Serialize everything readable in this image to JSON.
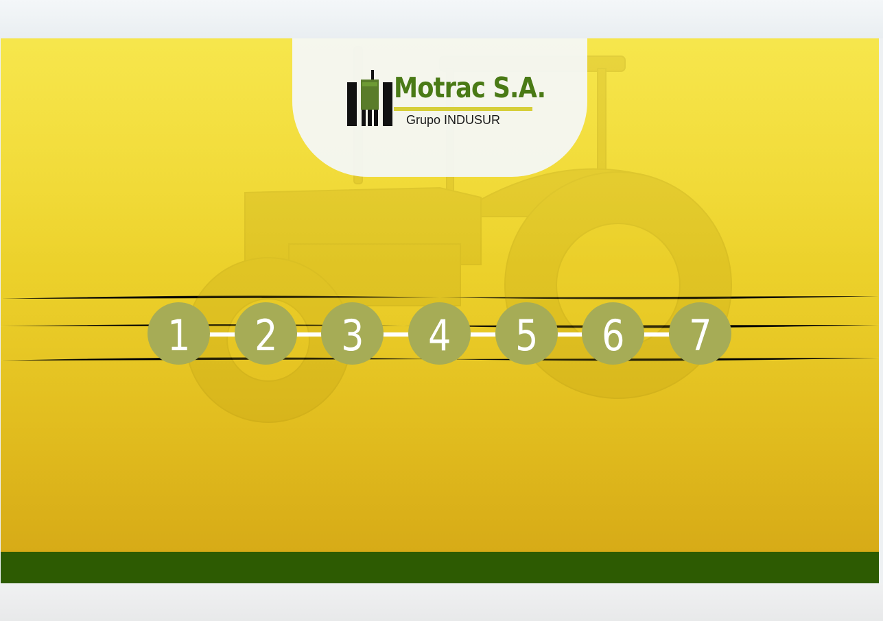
{
  "brand": {
    "name": "Motrac S.A.",
    "subtitle": "Grupo INDUSUR"
  },
  "colors": {
    "hero_yellow": "#efd62f",
    "step_circle": "#a6ac56",
    "brand_green": "#4a7a16",
    "brand_underline": "#d6cf3a",
    "band_green": "#2d5b02"
  },
  "steps": [
    {
      "label": "1"
    },
    {
      "label": "2"
    },
    {
      "label": "3"
    },
    {
      "label": "4"
    },
    {
      "label": "5"
    },
    {
      "label": "6"
    },
    {
      "label": "7"
    }
  ]
}
